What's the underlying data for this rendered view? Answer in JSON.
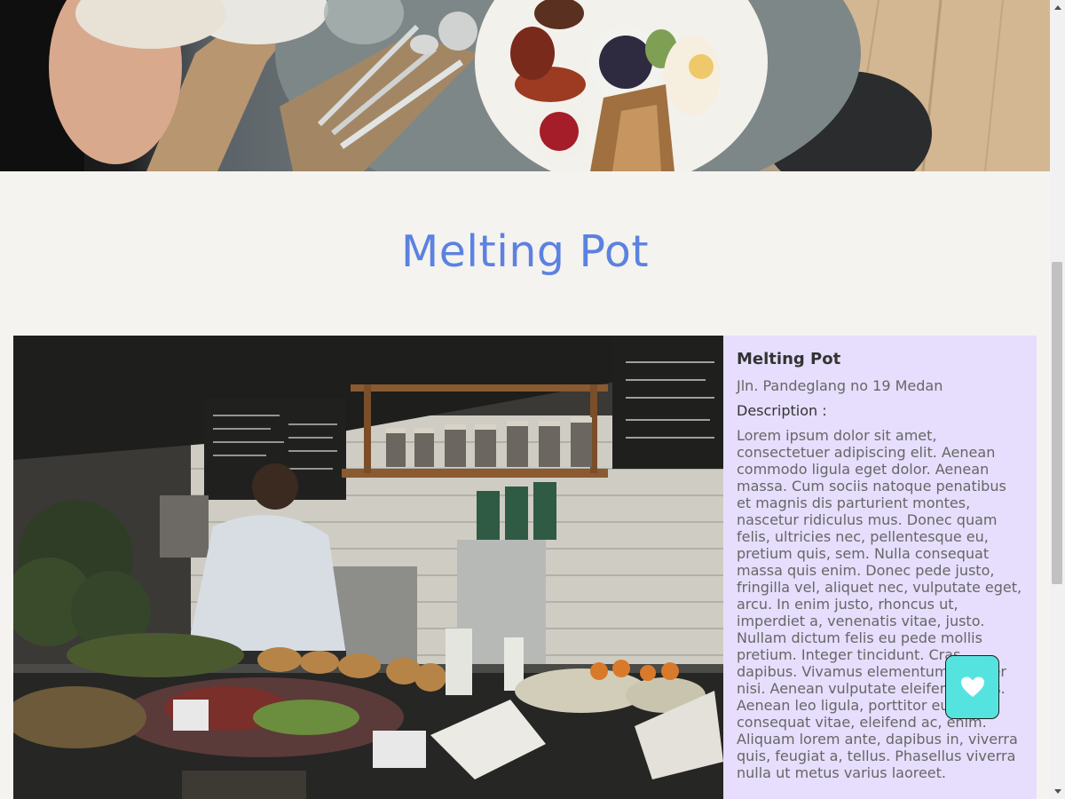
{
  "hero": {
    "image_alt": "Breakfast plate with bacon, toast, eggs and berries on a table"
  },
  "page": {
    "title": "Melting Pot"
  },
  "restaurant": {
    "name": "Melting Pot",
    "address": "Jln. Pandeglang no 19 Medan",
    "description_label": "Description :",
    "description": "Lorem ipsum dolor sit amet, consectetuer adipiscing elit. Aenean commodo ligula eget dolor. Aenean massa. Cum sociis natoque penatibus et magnis dis parturient montes, nascetur ridiculus mus. Donec quam felis, ultricies nec, pellentesque eu, pretium quis, sem. Nulla consequat massa quis enim. Donec pede justo, fringilla vel, aliquet nec, vulputate eget, arcu. In enim justo, rhoncus ut, imperdiet a, venenatis vitae, justo. Nullam dictum felis eu pede mollis pretium. Integer tincidunt. Cras dapibus. Vivamus elementum semper nisi. Aenean vulputate eleifend tellus. Aenean leo ligula, porttitor eu, consequat vitae, eleifend ac, enim. Aliquam lorem ante, dapibus in, viverra quis, feugiat a, tellus. Phasellus viverra nulla ut metus varius laoreet.",
    "image_alt": "Cafe interior with barista behind a counter of pastries and jars on shelves"
  },
  "favorite_button": {
    "icon": "heart-icon"
  },
  "colors": {
    "title": "#5b82e0",
    "info_background": "#e6defc",
    "favorite_button": "#55e3e0",
    "page_background": "#f5f3ef"
  }
}
